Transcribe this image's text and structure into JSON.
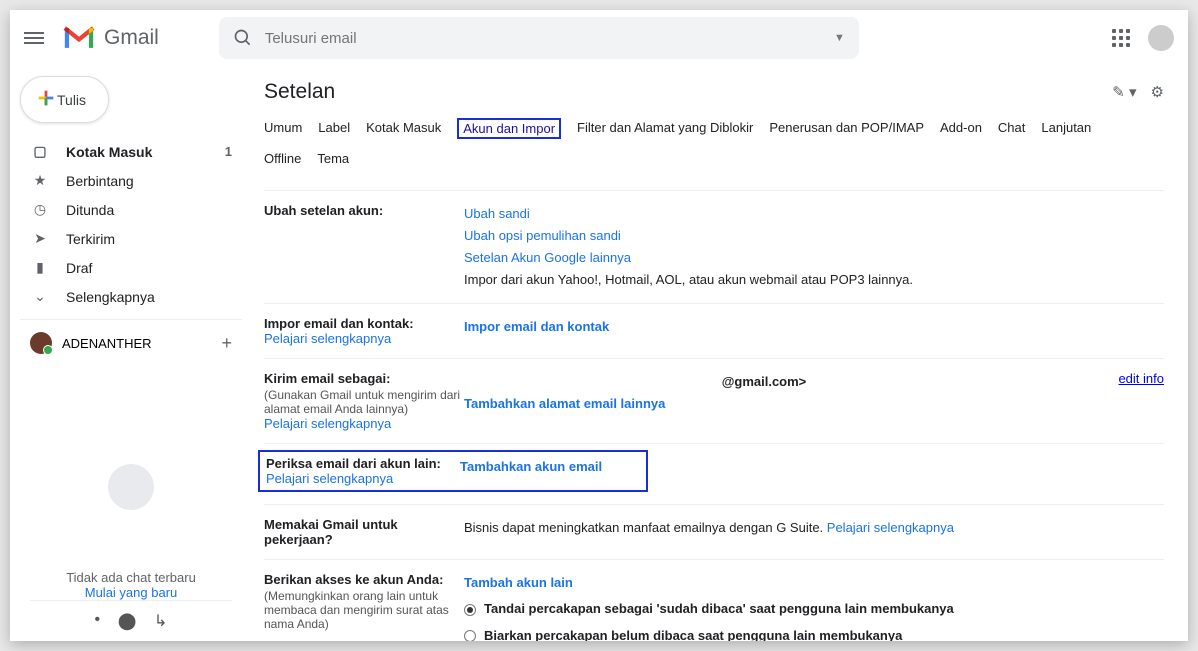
{
  "header": {
    "product": "Gmail",
    "search_placeholder": "Telusuri email"
  },
  "sidebar": {
    "compose": "Tulis",
    "items": [
      {
        "icon": "inbox",
        "label": "Kotak Masuk",
        "count": "1",
        "bold": true
      },
      {
        "icon": "star",
        "label": "Berbintang"
      },
      {
        "icon": "clock",
        "label": "Ditunda"
      },
      {
        "icon": "send",
        "label": "Terkirim"
      },
      {
        "icon": "file",
        "label": "Draf"
      },
      {
        "icon": "chev",
        "label": "Selengkapnya"
      }
    ],
    "label_name": "ADENANTHER",
    "chat_empty": "Tidak ada chat terbaru",
    "chat_link": "Mulai yang baru"
  },
  "settings": {
    "title": "Setelan",
    "tabs": [
      "Umum",
      "Label",
      "Kotak Masuk",
      "Akun dan Impor",
      "Filter dan Alamat yang Diblokir",
      "Penerusan dan POP/IMAP",
      "Add-on",
      "Chat",
      "Lanjutan",
      "Offline",
      "Tema"
    ],
    "active_tab": "Akun dan Impor",
    "sec1": {
      "h": "Ubah setelan akun:",
      "l1": "Ubah sandi",
      "l2": "Ubah opsi pemulihan sandi",
      "l3": "Setelan Akun Google lainnya",
      "t": "Impor dari akun Yahoo!, Hotmail, AOL, atau akun webmail atau POP3 lainnya."
    },
    "sec2": {
      "h": "Impor email dan kontak:",
      "learn": "Pelajari selengkapnya",
      "link": "Impor email dan kontak"
    },
    "sec3": {
      "h": "Kirim email sebagai:",
      "sub": "(Gunakan Gmail untuk mengirim dari alamat email Anda lainnya)",
      "learn": "Pelajari selengkapnya",
      "email": "@gmail.com>",
      "add": "Tambahkan alamat email lainnya",
      "edit": "edit info"
    },
    "sec4": {
      "h": "Periksa email dari akun lain:",
      "learn": "Pelajari selengkapnya",
      "add": "Tambahkan akun email"
    },
    "sec5": {
      "h": "Memakai Gmail untuk pekerjaan?",
      "t": "Bisnis dapat meningkatkan manfaat emailnya dengan G Suite. ",
      "link": "Pelajari selengkapnya"
    },
    "sec6": {
      "h": "Berikan akses ke akun Anda:",
      "sub": "(Memungkinkan orang lain untuk membaca dan mengirim surat atas nama Anda)",
      "add": "Tambah akun lain",
      "r1": "Tandai percakapan sebagai 'sudah dibaca' saat pengguna lain membukanya",
      "r2": "Biarkan percakapan belum dibaca saat pengguna lain membukanya"
    }
  }
}
